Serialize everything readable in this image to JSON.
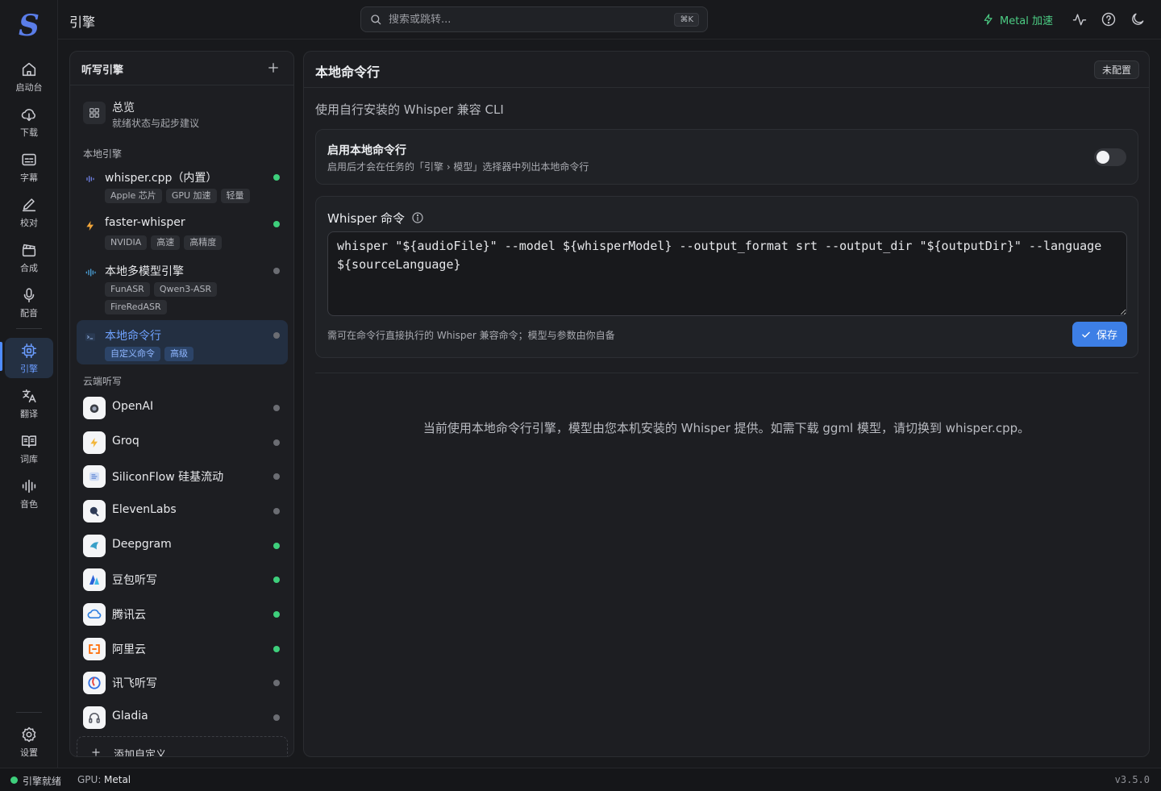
{
  "app": {
    "logo_letter": "S",
    "page_title": "引擎",
    "version": "v3.5.0"
  },
  "search": {
    "placeholder": "搜索或跳转...",
    "shortcut": "⌘K"
  },
  "topbar": {
    "metal_label": "Metal 加速"
  },
  "nav": {
    "items": [
      {
        "label": "启动台",
        "icon": "home-icon"
      },
      {
        "label": "下载",
        "icon": "cloud-download-icon"
      },
      {
        "label": "字幕",
        "icon": "subtitle-icon"
      },
      {
        "label": "校对",
        "icon": "pen-icon"
      },
      {
        "label": "合成",
        "icon": "clapperboard-icon"
      },
      {
        "label": "配音",
        "icon": "microphone-icon"
      },
      {
        "label": "引擎",
        "icon": "chip-icon",
        "active": true
      },
      {
        "label": "翻译",
        "icon": "translate-icon"
      },
      {
        "label": "词库",
        "icon": "book-icon"
      },
      {
        "label": "音色",
        "icon": "waveform-icon"
      }
    ],
    "settings_label": "设置"
  },
  "engine_list": {
    "title": "听写引擎",
    "overview": {
      "title": "总览",
      "subtitle": "就绪状态与起步建议"
    },
    "local_section": "本地引擎",
    "local_engines": [
      {
        "name": "whisper.cpp（内置）",
        "tags": [
          "Apple 芯片",
          "GPU 加速",
          "轻量"
        ],
        "status": "ready"
      },
      {
        "name": "faster-whisper",
        "tags": [
          "NVIDIA",
          "高速",
          "高精度"
        ],
        "status": "ready"
      },
      {
        "name": "本地多模型引擎",
        "tags": [
          "FunASR",
          "Qwen3-ASR",
          "FireRedASR"
        ],
        "status": "idle"
      },
      {
        "name": "本地命令行",
        "tags": [
          "自定义命令",
          "高级"
        ],
        "status": "idle",
        "active": true
      }
    ],
    "cloud_section": "云端听写",
    "cloud_engines": [
      {
        "name": "OpenAI",
        "status": "idle",
        "color": "#3a3d44"
      },
      {
        "name": "Groq",
        "status": "idle",
        "color": "#f2b63b"
      },
      {
        "name": "SiliconFlow 硅基流动",
        "status": "idle",
        "color": "#6b8fd6"
      },
      {
        "name": "ElevenLabs",
        "status": "idle",
        "color": "#2d3a55"
      },
      {
        "name": "Deepgram",
        "status": "ready",
        "color": "#3aa0c8"
      },
      {
        "name": "豆包听写",
        "status": "ready",
        "color": "#2a62d8"
      },
      {
        "name": "腾讯云",
        "status": "ready",
        "color": "#2f7fe0"
      },
      {
        "name": "阿里云",
        "status": "ready",
        "color": "#ff6a00"
      },
      {
        "name": "讯飞听写",
        "status": "idle",
        "color": "#2f6fe3"
      },
      {
        "name": "Gladia",
        "status": "idle",
        "color": "#555862"
      }
    ],
    "add_custom": "添加自定义"
  },
  "detail": {
    "title": "本地命令行",
    "badge": "未配置",
    "description": "使用自行安装的 Whisper 兼容 CLI",
    "enable": {
      "title": "启用本地命令行",
      "subtitle": "启用后才会在任务的「引擎 › 模型」选择器中列出本地命令行",
      "enabled": false
    },
    "command": {
      "title": "Whisper 命令",
      "value": "whisper \"${audioFile}\" --model ${whisperModel} --output_format srt --output_dir \"${outputDir}\" --language ${sourceLanguage}",
      "hint": "需可在命令行直接执行的 Whisper 兼容命令；模型与参数由你自备",
      "save_label": "保存"
    },
    "note": "当前使用本地命令行引擎，模型由您本机安装的 Whisper 提供。如需下载 ggml 模型，请切换到 whisper.cpp。"
  },
  "status": {
    "engine_status": "引擎就绪",
    "gpu_label": "GPU:",
    "gpu_value": "Metal"
  }
}
